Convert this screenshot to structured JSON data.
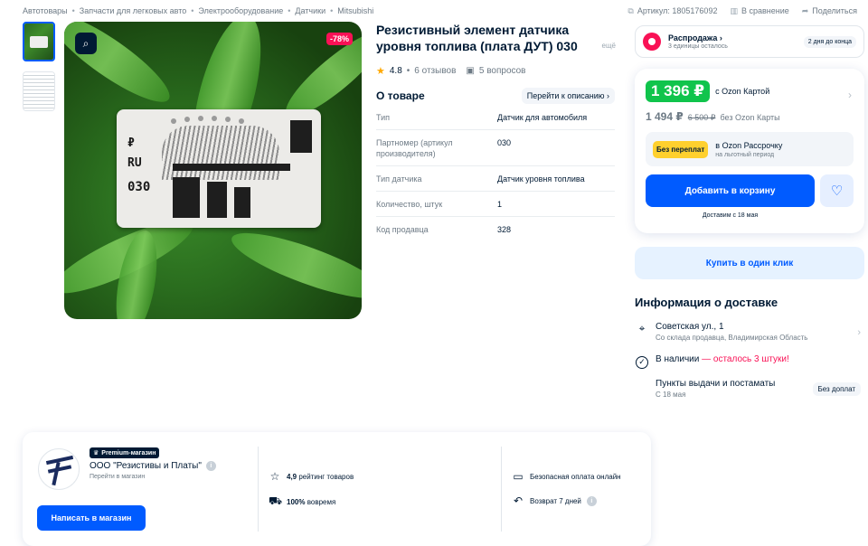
{
  "breadcrumbs": [
    "Автотовары",
    "Запчасти для легковых авто",
    "Электрооборудование",
    "Датчики",
    "Mitsubishi"
  ],
  "top_actions": {
    "article": "Артикул: 1805176092",
    "compare": "В сравнение",
    "share": "Поделиться"
  },
  "gallery": {
    "discount": "-78%",
    "board_marks": [
      "₽",
      "RU",
      "030"
    ]
  },
  "product": {
    "title": "Резистивный элемент датчика уровня топлива (плата ДУТ) 030",
    "more": "ещё",
    "rating": "4.8",
    "reviews": "6 отзывов",
    "questions": "5 вопросов"
  },
  "about": {
    "heading": "О товаре",
    "goto": "Перейти к описанию",
    "specs": [
      {
        "k": "Тип",
        "v": "Датчик для автомобиля"
      },
      {
        "k": "Партномер (артикул производителя)",
        "v": "030"
      },
      {
        "k": "Тип датчика",
        "v": "Датчик уровня топлива"
      },
      {
        "k": "Количество, штук",
        "v": "1"
      },
      {
        "k": "Код продавца",
        "v": "328"
      }
    ]
  },
  "sale": {
    "title": "Распродажа",
    "subtitle": "3 единицы осталось",
    "days": "2 дня до конца"
  },
  "price": {
    "ozon_price": "1 396 ₽",
    "ozon_label": "с Ozon Картой",
    "regular": "1 494 ₽",
    "old": "6 500 ₽",
    "regular_label": "без Ozon Карты",
    "installment_tag": "Без переплат",
    "installment_text": "в Ozon Рассрочку",
    "installment_sub": "на льготный период",
    "cart_button": "Добавить в корзину",
    "delivery_date": "Доставим с 18 мая"
  },
  "oneclick": "Купить в один клик",
  "delivery": {
    "title": "Информация о доставке",
    "address": "Советская ул., 1",
    "address_sub": "Со склада продавца, Владимирская Область",
    "stock": "В наличии",
    "stock_warn": "— осталось 3 штуки!",
    "pickup": "Пункты выдачи и постаматы",
    "pickup_sub": "С 18 мая",
    "pickup_badge": "Без доплат"
  },
  "shop": {
    "premium": "Premium-магазин",
    "name": "ООО \"Резистивы и Платы\"",
    "link": "Перейти в магазин",
    "button": "Написать в магазин",
    "rating_value": "4,9",
    "rating_label": "рейтинг товаров",
    "ontime_value": "100%",
    "ontime_label": "вовремя",
    "payment": "Безопасная оплата онлайн",
    "return": "Возврат 7 дней"
  },
  "colors": {
    "accent": "#005bff",
    "ozon_green": "#10c44c",
    "discount_pink": "#f91155",
    "installment_yellow": "#ffd02e"
  }
}
